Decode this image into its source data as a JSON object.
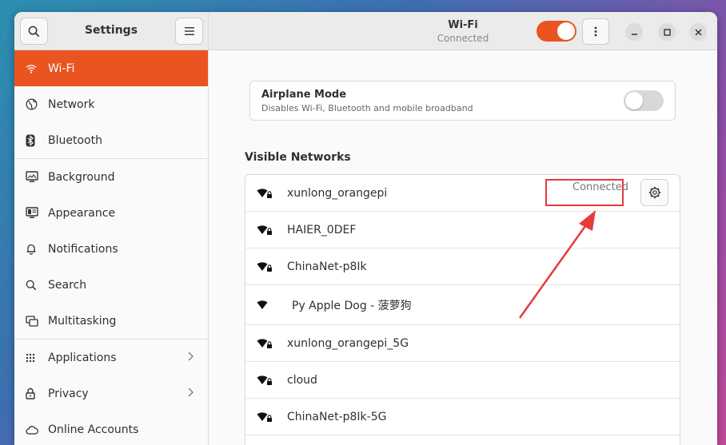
{
  "sidebar": {
    "title": "Settings",
    "items": [
      {
        "label": "Wi-Fi",
        "icon": "wifi-icon",
        "active": true
      },
      {
        "label": "Network",
        "icon": "globe-icon"
      },
      {
        "label": "Bluetooth",
        "icon": "bluetooth-icon"
      },
      {
        "label": "Background",
        "icon": "monitor-icon"
      },
      {
        "label": "Appearance",
        "icon": "appearance-icon"
      },
      {
        "label": "Notifications",
        "icon": "bell-icon"
      },
      {
        "label": "Search",
        "icon": "search-icon"
      },
      {
        "label": "Multitasking",
        "icon": "multitasking-icon"
      },
      {
        "label": "Applications",
        "icon": "grid-icon",
        "chevron": true
      },
      {
        "label": "Privacy",
        "icon": "lock-icon",
        "chevron": true
      },
      {
        "label": "Online Accounts",
        "icon": "cloud-icon"
      }
    ]
  },
  "header": {
    "title": "Wi-Fi",
    "subtitle": "Connected",
    "wifi_enabled": true
  },
  "airplane": {
    "title": "Airplane Mode",
    "description": "Disables Wi-Fi, Bluetooth and mobile broadband",
    "enabled": false
  },
  "networks": {
    "heading": "Visible Networks",
    "items": [
      {
        "ssid": "xunlong_orangepi",
        "secured": true,
        "status": "Connected"
      },
      {
        "ssid": "HAIER_0DEF",
        "secured": true
      },
      {
        "ssid": "ChinaNet-p8Ik",
        "secured": true
      },
      {
        "ssid": "Py Apple Dog - 菠萝狗",
        "secured": false
      },
      {
        "ssid": "xunlong_orangepi_5G",
        "secured": true
      },
      {
        "ssid": "cloud",
        "secured": true
      },
      {
        "ssid": "ChinaNet-p8Ik-5G",
        "secured": true
      }
    ]
  },
  "colors": {
    "accent": "#e95420",
    "annotation": "#e83a3a"
  }
}
